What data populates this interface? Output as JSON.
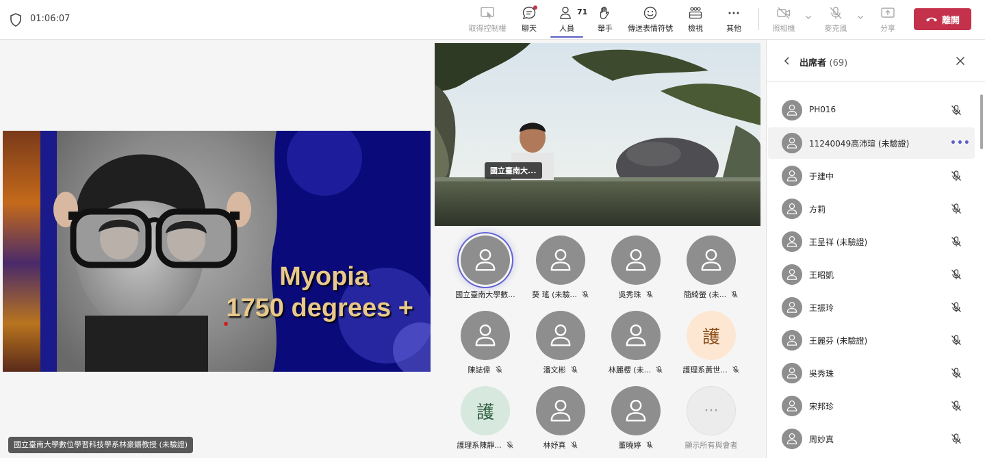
{
  "header": {
    "timer": "01:06:07",
    "buttons": {
      "take_control": "取得控制權",
      "chat": "聊天",
      "people": "人員",
      "people_count": "71",
      "raise_hand": "舉手",
      "reactions": "傳送表情符號",
      "view": "檢視",
      "more": "其他",
      "camera": "照相機",
      "mic": "麥克風",
      "share": "分享"
    },
    "leave_label": "離開",
    "colors": {
      "leave": "#c4314b",
      "accent": "#5b5fc7"
    }
  },
  "slide": {
    "line1": "Myopia",
    "line2": "1750 degrees +",
    "presenter_label": "國立臺南大學數位學習科技學系林豪鏘教授 (未驗證)"
  },
  "video": {
    "name_tag": "國立臺南大..."
  },
  "tiles": [
    {
      "name": "國立臺南大學數...",
      "type": "default",
      "speaking": true,
      "muted": false
    },
    {
      "name": "葵 瑤 (未驗...",
      "type": "default",
      "muted": true
    },
    {
      "name": "吳秀珠",
      "type": "default",
      "muted": true
    },
    {
      "name": "簡綺螢 (未...",
      "type": "default",
      "muted": true
    },
    {
      "name": "陳誌偉",
      "type": "default",
      "muted": true
    },
    {
      "name": "潘文彬",
      "type": "default",
      "muted": true
    },
    {
      "name": "林麗櫻 (未...",
      "type": "default",
      "muted": true
    },
    {
      "name": "護理系黃世...",
      "type": "mono-peach",
      "initial": "護",
      "muted": true
    },
    {
      "name": "護理系陳靜...",
      "type": "mono-green",
      "initial": "護",
      "muted": true
    },
    {
      "name": "林妤真",
      "type": "default",
      "muted": true
    },
    {
      "name": "董曉婷",
      "type": "default",
      "muted": true
    },
    {
      "name": "顯示所有與會者",
      "type": "more",
      "initial": "···",
      "muted": false
    }
  ],
  "panel": {
    "title": "出席者",
    "count": "(69)",
    "participants": [
      {
        "name": "PH016",
        "muted": true
      },
      {
        "name": "11240049高沛瑄 (未驗證)",
        "highlighted": true,
        "more": "•••"
      },
      {
        "name": "于建中",
        "muted": true
      },
      {
        "name": "方莉",
        "muted": true
      },
      {
        "name": "王呈祥 (未驗證)",
        "muted": true
      },
      {
        "name": "王昭凱",
        "muted": true
      },
      {
        "name": "王振玲",
        "muted": true
      },
      {
        "name": "王麗芬 (未驗證)",
        "muted": true
      },
      {
        "name": "吳秀珠",
        "muted": true
      },
      {
        "name": "宋邦珍",
        "muted": true
      },
      {
        "name": "周妙真",
        "muted": true
      }
    ]
  }
}
